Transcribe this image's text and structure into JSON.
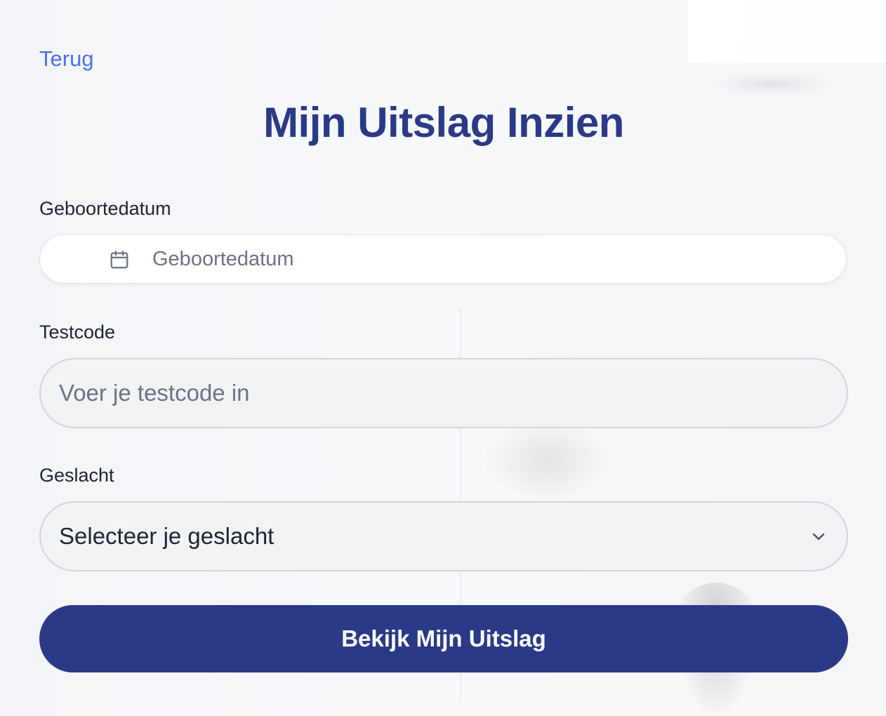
{
  "nav": {
    "back_label": "Terug"
  },
  "page": {
    "title": "Mijn Uitslag Inzien"
  },
  "form": {
    "birthdate": {
      "label": "Geboortedatum",
      "placeholder": "Geboortedatum",
      "value": "",
      "icon": "calendar-icon"
    },
    "testcode": {
      "label": "Testcode",
      "placeholder": "Voer je testcode in",
      "value": ""
    },
    "gender": {
      "label": "Geslacht",
      "selected": "Selecteer je geslacht",
      "icon": "chevron-down-icon"
    },
    "submit_label": "Bekijk Mijn Uitslag"
  },
  "colors": {
    "primary": "#2b3a86",
    "link": "#4a72e6",
    "field_bg": "#f2f3f5",
    "field_border": "#d3d6db",
    "text": "#1e2433",
    "placeholder": "#6b7484"
  }
}
